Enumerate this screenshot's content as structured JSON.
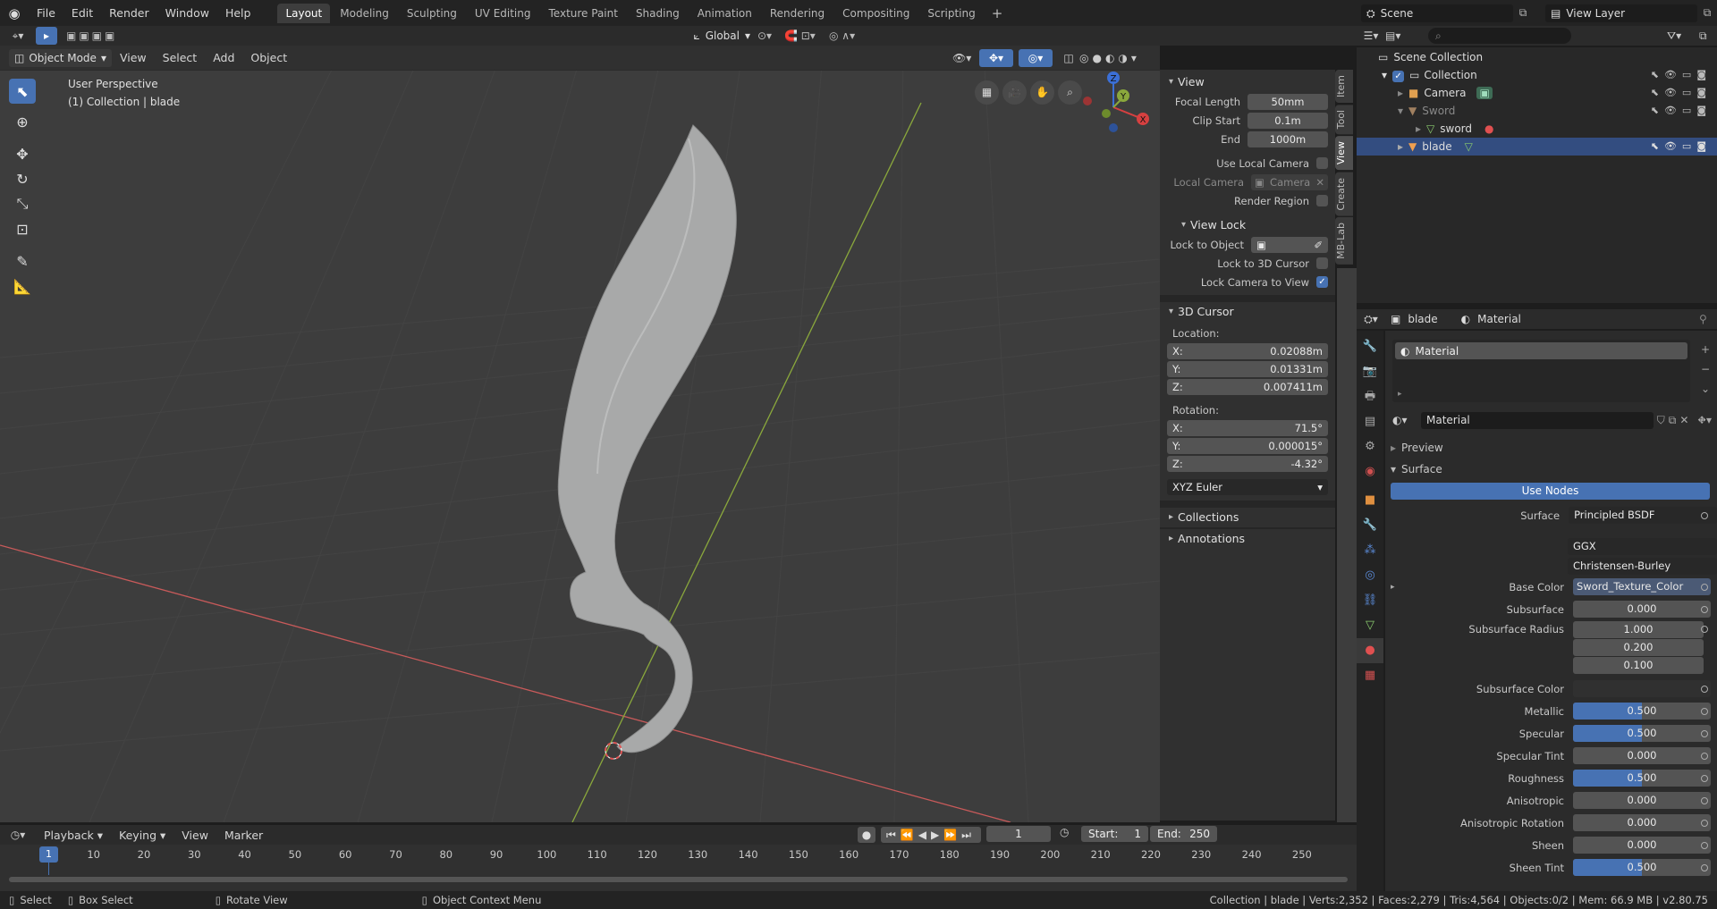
{
  "menu": [
    "File",
    "Edit",
    "Render",
    "Window",
    "Help"
  ],
  "workspaces": [
    "Layout",
    "Modeling",
    "Sculpting",
    "UV Editing",
    "Texture Paint",
    "Shading",
    "Animation",
    "Rendering",
    "Compositing",
    "Scripting"
  ],
  "scene": "Scene",
  "view_layer": "View Layer",
  "header": {
    "transform_orientation": "Global"
  },
  "viewport_header": {
    "mode": "Object Mode",
    "menus": [
      "View",
      "Select",
      "Add",
      "Object"
    ]
  },
  "viewport": {
    "perspective": "User Perspective",
    "collection_info": "(1) Collection | blade"
  },
  "gizmo": {
    "x": "X",
    "y": "Y",
    "z": "Z"
  },
  "npanel": {
    "view_title": "View",
    "focal_length_label": "Focal Length",
    "focal_length": "50mm",
    "clip_start_label": "Clip Start",
    "clip_start": "0.1m",
    "end_label": "End",
    "end": "1000m",
    "use_local_camera": "Use Local Camera",
    "local_camera_label": "Local Camera",
    "local_camera": "Camera",
    "render_region": "Render Region",
    "view_lock_title": "View Lock",
    "lock_to_object": "Lock to Object",
    "lock_to_cursor": "Lock to 3D Cursor",
    "lock_camera": "Lock Camera to View",
    "cursor_title": "3D Cursor",
    "location_label": "Location:",
    "loc_x_label": "X:",
    "loc_x": "0.02088m",
    "loc_y_label": "Y:",
    "loc_y": "0.01331m",
    "loc_z_label": "Z:",
    "loc_z": "0.007411m",
    "rotation_label": "Rotation:",
    "rot_x_label": "X:",
    "rot_x": "71.5°",
    "rot_y_label": "Y:",
    "rot_y": "0.000015°",
    "rot_z_label": "Z:",
    "rot_z": "-4.32°",
    "rotation_mode": "XYZ Euler",
    "collections": "Collections",
    "annotations": "Annotations",
    "tabs": [
      "Item",
      "Tool",
      "View",
      "Create",
      "MB-Lab"
    ]
  },
  "outliner": {
    "scene_collection": "Scene Collection",
    "collection": "Collection",
    "camera": "Camera",
    "sword_parent": "Sword",
    "sword_mesh": "sword",
    "blade": "blade"
  },
  "properties": {
    "object": "blade",
    "material_tab": "Material",
    "slot": "Material",
    "material_name": "Material",
    "preview": "Preview",
    "surface_section": "Surface",
    "use_nodes": "Use Nodes",
    "surface_label": "Surface",
    "surface_value": "Principled BSDF",
    "distribution": "GGX",
    "subsurface_method": "Christensen-Burley",
    "base_color_label": "Base Color",
    "base_color": "Sword_Texture_Color",
    "rows": [
      {
        "label": "Subsurface",
        "value": "0.000",
        "fill": 0
      },
      {
        "label": "Subsurface Color",
        "value": "",
        "fill": 0
      },
      {
        "label": "Metallic",
        "value": "0.500",
        "fill": 0.5
      },
      {
        "label": "Specular",
        "value": "0.500",
        "fill": 0.5
      },
      {
        "label": "Specular Tint",
        "value": "0.000",
        "fill": 0
      },
      {
        "label": "Roughness",
        "value": "0.500",
        "fill": 0.5
      },
      {
        "label": "Anisotropic",
        "value": "0.000",
        "fill": 0
      },
      {
        "label": "Anisotropic Rotation",
        "value": "0.000",
        "fill": 0
      },
      {
        "label": "Sheen",
        "value": "0.000",
        "fill": 0
      },
      {
        "label": "Sheen Tint",
        "value": "0.500",
        "fill": 0.5
      }
    ],
    "subsurface_radius_label": "Subsurface Radius",
    "subsurface_radius": [
      "1.000",
      "0.200",
      "0.100"
    ]
  },
  "timeline": {
    "menus": [
      "Playback",
      "Keying",
      "View",
      "Marker"
    ],
    "current_frame": "1",
    "start_label": "Start:",
    "start": "1",
    "end_label": "End:",
    "end": "250",
    "ticks": [
      "1",
      "10",
      "20",
      "30",
      "40",
      "50",
      "60",
      "70",
      "80",
      "90",
      "100",
      "110",
      "120",
      "130",
      "140",
      "150",
      "160",
      "170",
      "180",
      "190",
      "200",
      "210",
      "220",
      "230",
      "240",
      "250"
    ]
  },
  "statusbar": {
    "select": "Select",
    "box_select": "Box Select",
    "rotate_view": "Rotate View",
    "context_menu": "Object Context Menu",
    "stats": "Collection | blade | Verts:2,352 | Faces:2,279 | Tris:4,564 | Objects:0/2 | Mem: 66.9 MB | v2.80.75"
  }
}
